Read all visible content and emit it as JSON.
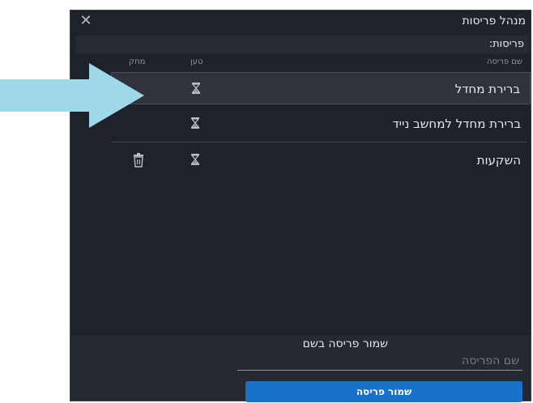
{
  "window": {
    "title": "מנהל פריסות",
    "close_glyph": "✕"
  },
  "section": {
    "label": "פריסות:"
  },
  "columns": {
    "name": "שם פריסה",
    "load": "טען",
    "delete": "מחק"
  },
  "layouts": [
    {
      "name": "ברירת מחדל",
      "selected": true,
      "deletable": false
    },
    {
      "name": "ברירת מחדל למחשב נייד",
      "selected": false,
      "deletable": false
    },
    {
      "name": "השקעות",
      "selected": false,
      "deletable": true
    }
  ],
  "save": {
    "heading": "שמור פריסה בשם",
    "placeholder": "שם הפריסה",
    "button_label": "שמור פריסה"
  },
  "icons": {
    "load": "hourglass-icon",
    "delete": "trash-icon",
    "close": "close-icon",
    "pointer": "arrow-icon"
  },
  "colors": {
    "accent": "#1a72c8",
    "arrow": "#9fd8e8",
    "background": "#1e222a"
  }
}
